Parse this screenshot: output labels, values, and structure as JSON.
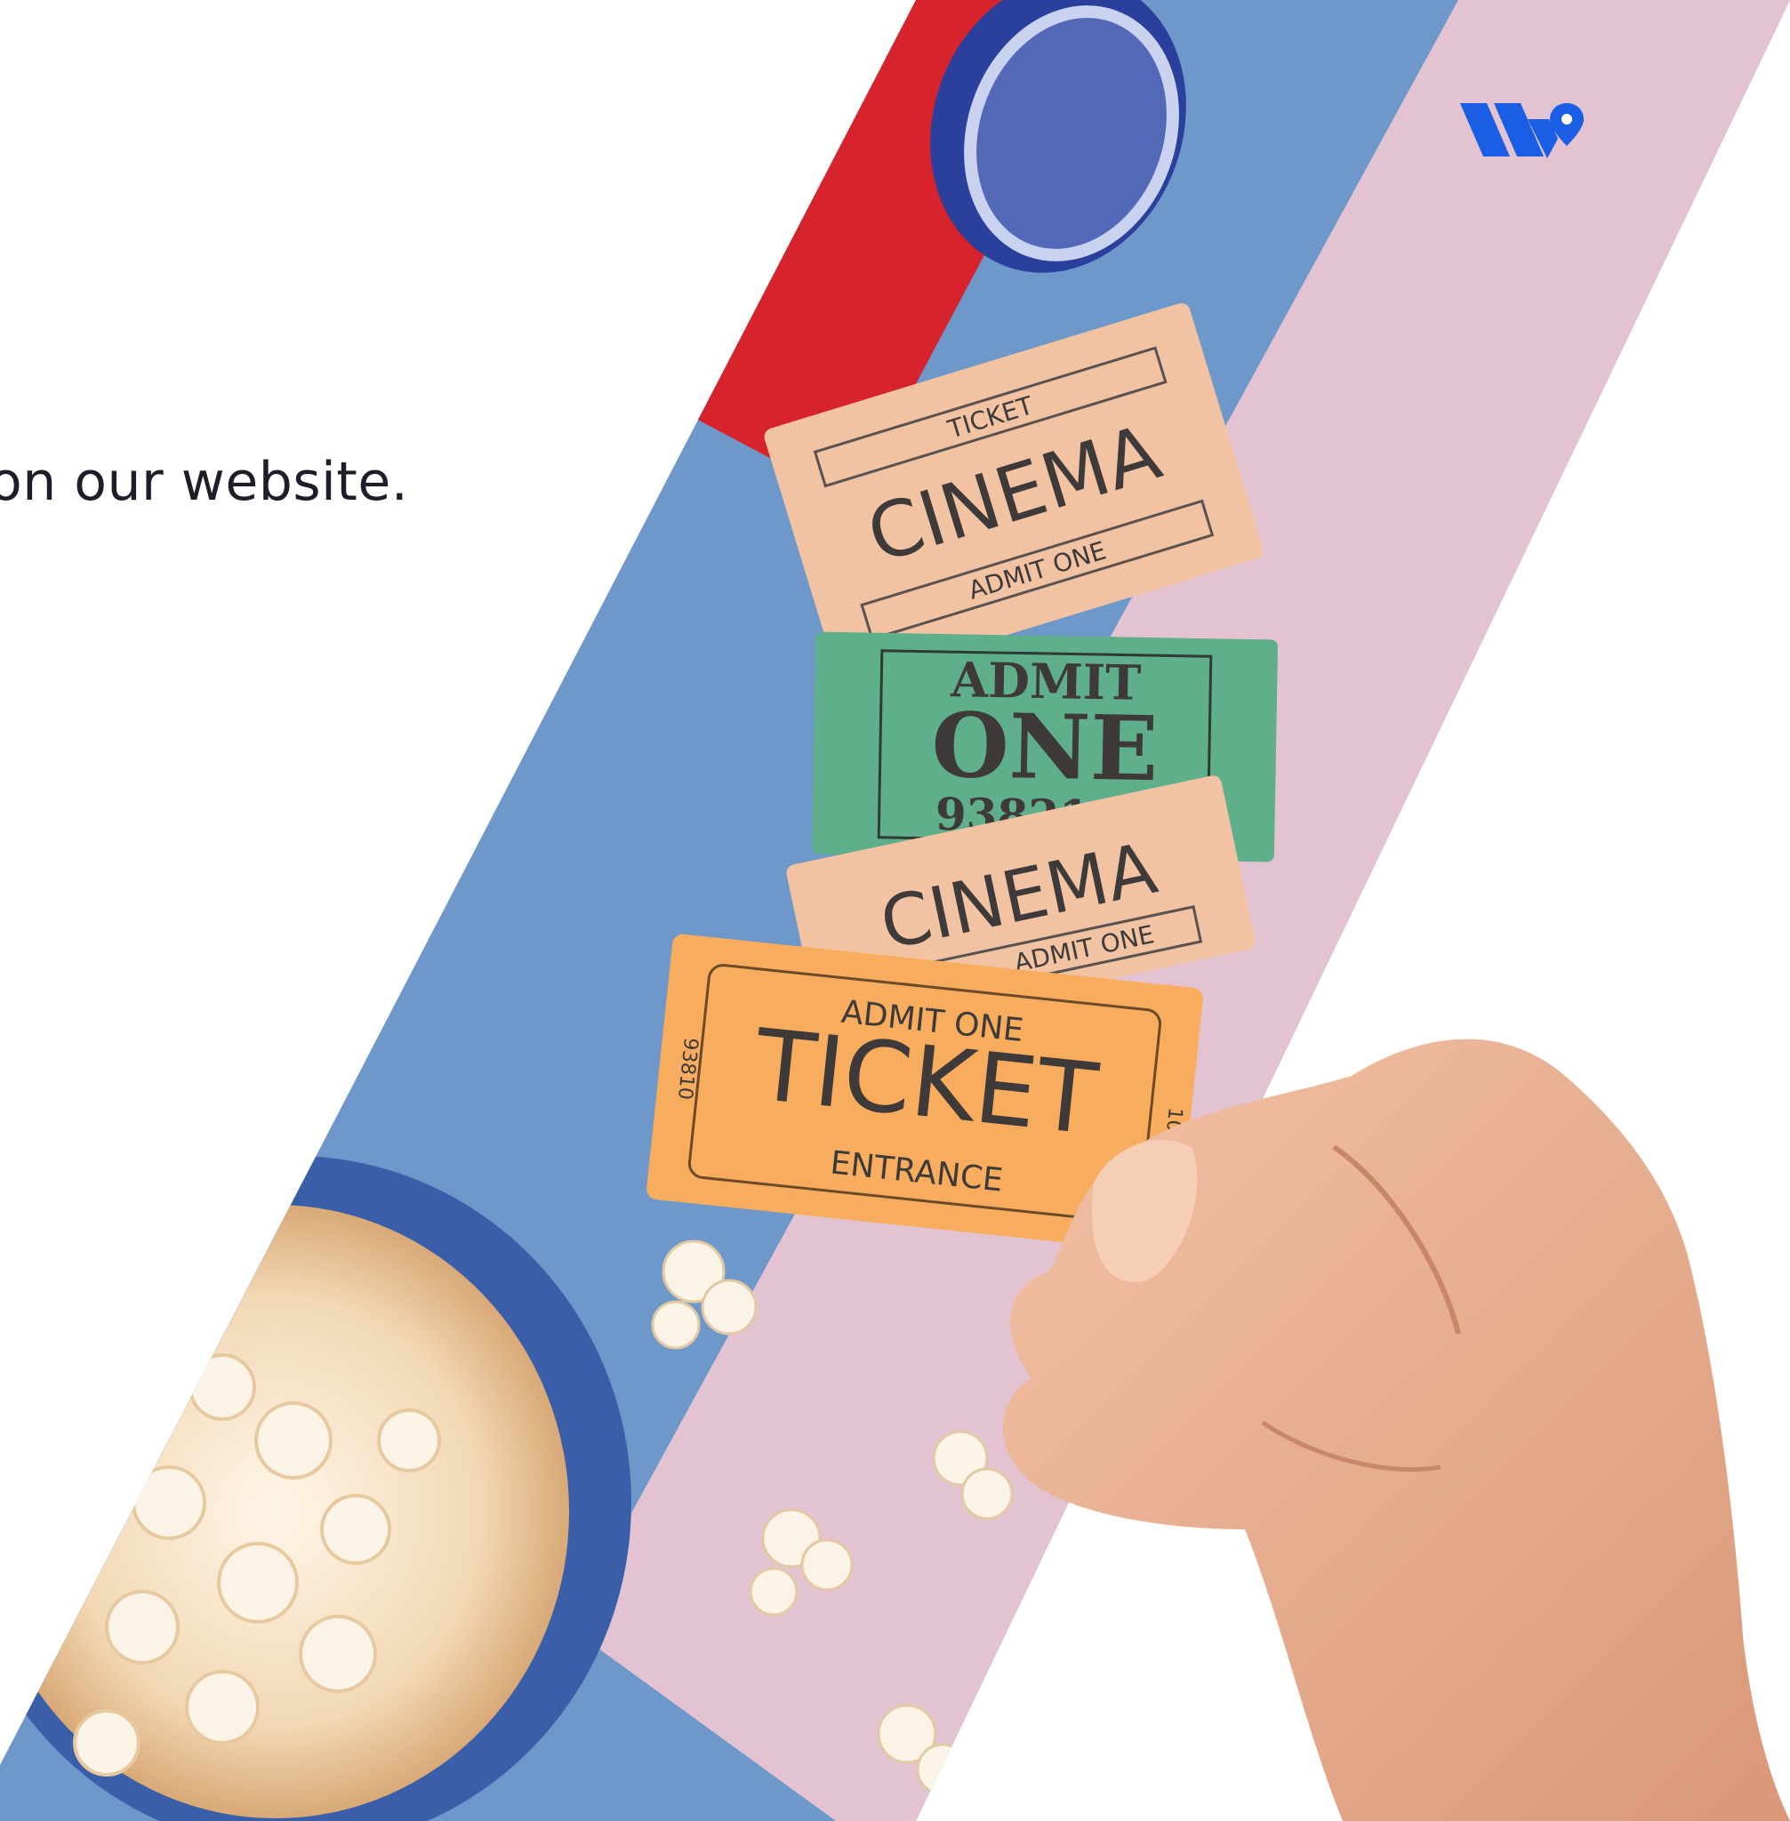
{
  "headline": "on our website.",
  "brand": {
    "logo_icon": "w-location-pin-logo",
    "color": "#1a5ee6"
  },
  "photo": {
    "tickets": [
      {
        "top": "TICKET",
        "main": "CINEMA",
        "bottom": "ADMIT ONE"
      },
      {
        "top": "ADMIT",
        "main": "ONE",
        "number": "9382199"
      },
      {
        "main": "CINEMA",
        "bottom": "ADMIT ONE"
      },
      {
        "top": "ADMIT ONE",
        "main": "TICKET",
        "bottom": "ENTRANCE",
        "side_left": "93810",
        "side_right": "10"
      }
    ]
  },
  "colors": {
    "blue_paper": "#6d98c9",
    "pink_paper": "#e3c3d1",
    "peach_ticket": "#f1c3a2",
    "green_ticket": "#5fae8c",
    "orange_ticket": "#f7ad5d",
    "cup_red": "#d6232c",
    "cup_blue": "#2b3f9c"
  }
}
